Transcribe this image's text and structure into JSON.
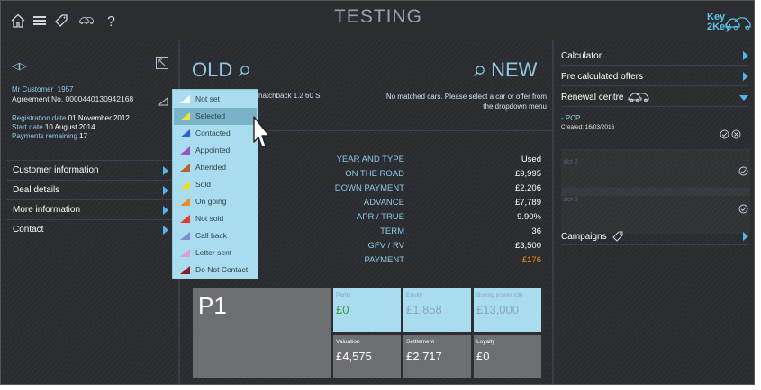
{
  "header": {
    "title": "TESTING",
    "logo_text_1": "Key",
    "logo_text_2": "2Key",
    "icons": [
      "home-icon",
      "menu-icon",
      "tag-icon",
      "cars-icon",
      "help-icon"
    ]
  },
  "customer": {
    "name": "Mr Customer_1957",
    "agreement": "Agreement No. 0000440130942168",
    "registration_label": "Registration date",
    "registration_value": "01 November 2012",
    "start_label": "Start date",
    "start_value": "10 August 2014",
    "payments_label": "Payments remaining",
    "payments_value": "17"
  },
  "left_menu": [
    {
      "label": "Customer information"
    },
    {
      "label": "Deal details"
    },
    {
      "label": "More information"
    },
    {
      "label": "Contact"
    }
  ],
  "center": {
    "old_label": "OLD",
    "new_label": "NEW",
    "car_description": "hatchback 1.2 60 S",
    "no_match_text": "No matched cars. Please select a car or offer from the dropdown menu"
  },
  "finance": [
    {
      "label": "YEAR AND TYPE",
      "value": "Used"
    },
    {
      "label": "ON THE ROAD",
      "value": "£9,995"
    },
    {
      "label": "DOWN PAYMENT",
      "value": "£2,206"
    },
    {
      "label": "ADVANCE",
      "value": "£7,789"
    },
    {
      "label": "APR / TRUE",
      "value": "9.90%"
    },
    {
      "label": "TERM",
      "value": "36"
    },
    {
      "label": "GFV / RV",
      "value": "£3,500"
    },
    {
      "label": "PAYMENT",
      "value": "£176",
      "highlight": "#f28a1e"
    }
  ],
  "tiles": {
    "p1": "P1",
    "parity": {
      "label": "Parity",
      "value": "£0",
      "color": "#3a9a48"
    },
    "equity": {
      "label": "Equity",
      "value": "£1,858"
    },
    "buying_power": {
      "label": "Buying power x36",
      "value": "£13,000"
    },
    "valuation": {
      "label": "Valuation",
      "value": "£4,575"
    },
    "settlement": {
      "label": "Settlement",
      "value": "£2,717"
    },
    "loyalty": {
      "label": "Loyalty",
      "value": "£0"
    }
  },
  "right_panel": {
    "calculator": "Calculator",
    "pre_calculated": "Pre calculated offers",
    "renewal_centre": "Renewal centre",
    "pcp_title": "- PCP",
    "pcp_created": "Created: 16/03/2016",
    "slot2": "slot 2",
    "slot3": "slot 3",
    "campaigns": "Campaigns"
  },
  "status_dropdown": {
    "selected": "Selected",
    "items": [
      {
        "label": "Not set",
        "color": "#ffffff"
      },
      {
        "label": "Selected",
        "color": "#f4e23c"
      },
      {
        "label": "Contacted",
        "color": "#2b5fd9"
      },
      {
        "label": "Appointed",
        "color": "#9b4fc2"
      },
      {
        "label": "Attended",
        "color": "#b5652a"
      },
      {
        "label": "Sold",
        "color": "#e9d93a"
      },
      {
        "label": "On going",
        "color": "#f08a24"
      },
      {
        "label": "Not sold",
        "color": "#e23b2b"
      },
      {
        "label": "Call back",
        "color": "#7d8ed0"
      },
      {
        "label": "Letter sent",
        "color": "#d9a0d6"
      },
      {
        "label": "Do Not Contact",
        "color": "#8b1f1f"
      }
    ]
  }
}
